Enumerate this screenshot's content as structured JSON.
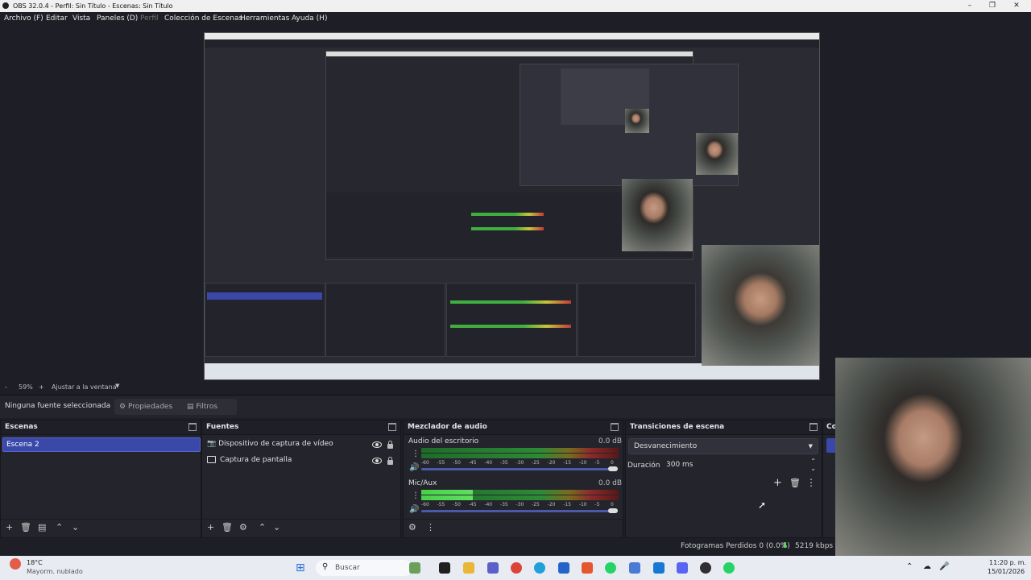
{
  "window": {
    "title": "OBS 32.0.4 - Perfil: Sin Título - Escenas: Sin Título"
  },
  "menu": {
    "items": [
      "Archivo (F)",
      "Editar",
      "Vista",
      "Paneles (D)",
      "Perfil",
      "Colección de Escenas",
      "Herramientas",
      "Ayuda (H)"
    ]
  },
  "zoom": {
    "minus": "-",
    "value": "59%",
    "plus": "+",
    "fit": "Ajustar a la ventana"
  },
  "source_bar": {
    "selection": "Ninguna fuente seleccionada",
    "properties": "Propiedades",
    "filters": "Filtros"
  },
  "scenes": {
    "title": "Escenas",
    "items": [
      "Escena 2"
    ]
  },
  "sources": {
    "title": "Fuentes",
    "items": [
      "Dispositivo de captura de vídeo",
      "Captura de pantalla"
    ]
  },
  "mixer": {
    "title": "Mezclador de audio",
    "tracks": [
      {
        "name": "Audio del escritorio",
        "db": "0.0 dB",
        "level": 0
      },
      {
        "name": "Mic/Aux",
        "db": "0.0 dB",
        "level": 0.26
      }
    ],
    "ticks": [
      "-60",
      "-55",
      "-50",
      "-45",
      "-40",
      "-35",
      "-30",
      "-25",
      "-20",
      "-15",
      "-10",
      "-5",
      "0"
    ]
  },
  "transitions": {
    "title": "Transiciones de escena",
    "selected": "Desvanecimiento",
    "duration_label": "Duración",
    "duration_value": "300 ms"
  },
  "controls": {
    "title_fragment": "Co"
  },
  "status": {
    "dropped": "Fotogramas Perdidos 0 (0.0%)",
    "bitrate": "5219 kbps"
  },
  "taskbar": {
    "weather_temp": "18°C",
    "weather_desc": "Mayorm. nublado",
    "search_placeholder": "Buscar",
    "time": "11:20 p. m.",
    "date": "15/01/2026"
  },
  "colors": {
    "accent": "#3a48a8",
    "bg": "#1e1f26",
    "dock": "#24252c"
  }
}
